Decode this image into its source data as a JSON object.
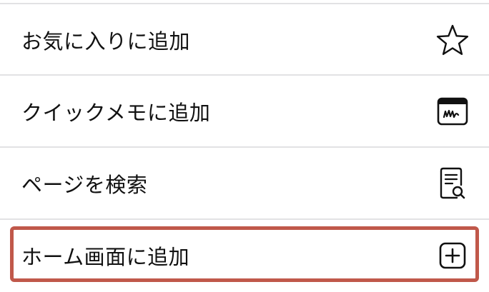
{
  "menu": {
    "items": [
      {
        "label": "お気に入りに追加",
        "icon": "star-icon"
      },
      {
        "label": "クイックメモに追加",
        "icon": "quick-note-icon"
      },
      {
        "label": "ページを検索",
        "icon": "find-on-page-icon"
      },
      {
        "label": "ホーム画面に追加",
        "icon": "add-square-icon"
      }
    ],
    "highlighted_item": "ホーム画面に追加",
    "highlight_color": "#c0584a"
  }
}
